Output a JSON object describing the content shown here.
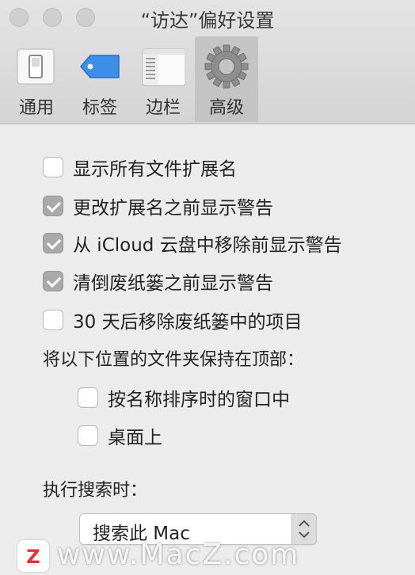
{
  "window": {
    "title": "“访达”偏好设置",
    "traffic_lights": [
      "close",
      "minimize",
      "zoom"
    ]
  },
  "toolbar": {
    "tabs": [
      {
        "label": "通用",
        "icon": "switch-icon"
      },
      {
        "label": "标签",
        "icon": "tag-icon"
      },
      {
        "label": "边栏",
        "icon": "sidebar-icon"
      },
      {
        "label": "高级",
        "icon": "gear-icon",
        "active": true
      }
    ]
  },
  "options": [
    {
      "label": "显示所有文件扩展名",
      "checked": false
    },
    {
      "label": "更改扩展名之前显示警告",
      "checked": true
    },
    {
      "label": "从 iCloud 云盘中移除前显示警告",
      "checked": true
    },
    {
      "label": "清倒废纸篓之前显示警告",
      "checked": true
    },
    {
      "label": "30 天后移除废纸篓中的项目",
      "checked": false
    }
  ],
  "keep_on_top": {
    "heading": "将以下位置的文件夹保持在顶部：",
    "items": [
      {
        "label": "按名称排序时的窗口中",
        "checked": false
      },
      {
        "label": "桌面上",
        "checked": false
      }
    ]
  },
  "search": {
    "heading": "执行搜索时：",
    "selected": "搜索此 Mac"
  },
  "watermark": {
    "logo_letter": "Z",
    "text": "www.MacZ.com"
  }
}
